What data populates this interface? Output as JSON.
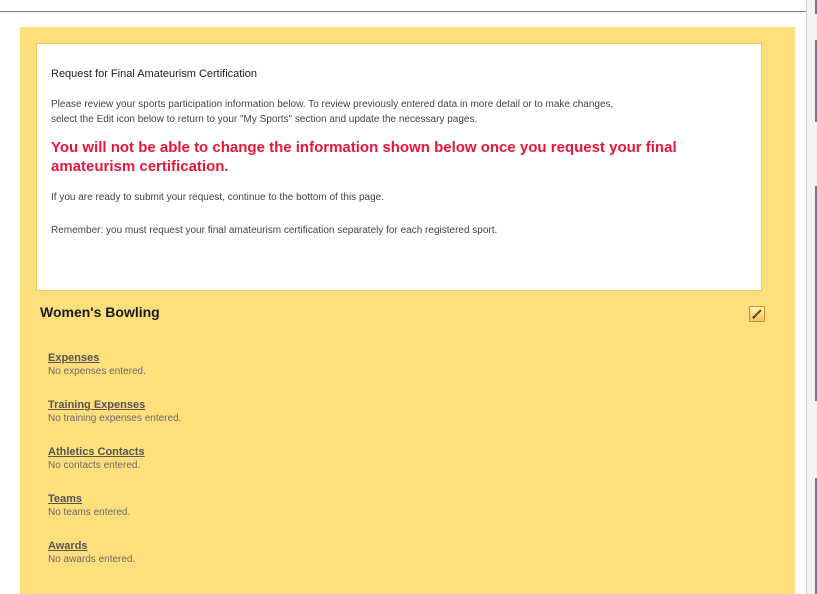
{
  "notice": {
    "title": "Request for Final Amateurism Certification",
    "review_line_1": "Please review your sports participation information below.  To review previously entered data in more detail or to make changes,",
    "review_line_2": "select the Edit icon below to return to your \"My Sports\" section and update the necessary pages.",
    "warning": "You will not be able to change the information shown below once you request your final amateurism certification.",
    "ready_text": "If you are ready to submit your request, continue to the bottom of this page.",
    "remember_text": "Remember: you must request your final amateurism certification separately for each registered sport."
  },
  "sport": {
    "name": "Women's Bowling",
    "edit_icon": "pencil-icon"
  },
  "sections": [
    {
      "label": "Expenses",
      "status": "No expenses entered."
    },
    {
      "label": "Training Expenses",
      "status": "No training expenses entered."
    },
    {
      "label": "Athletics Contacts",
      "status": "No contacts entered."
    },
    {
      "label": "Teams",
      "status": "No teams entered."
    },
    {
      "label": "Awards",
      "status": "No awards entered."
    }
  ],
  "colors": {
    "panel": "#ffdf7c",
    "warning": "#e8163a",
    "border": "#e8c766"
  }
}
